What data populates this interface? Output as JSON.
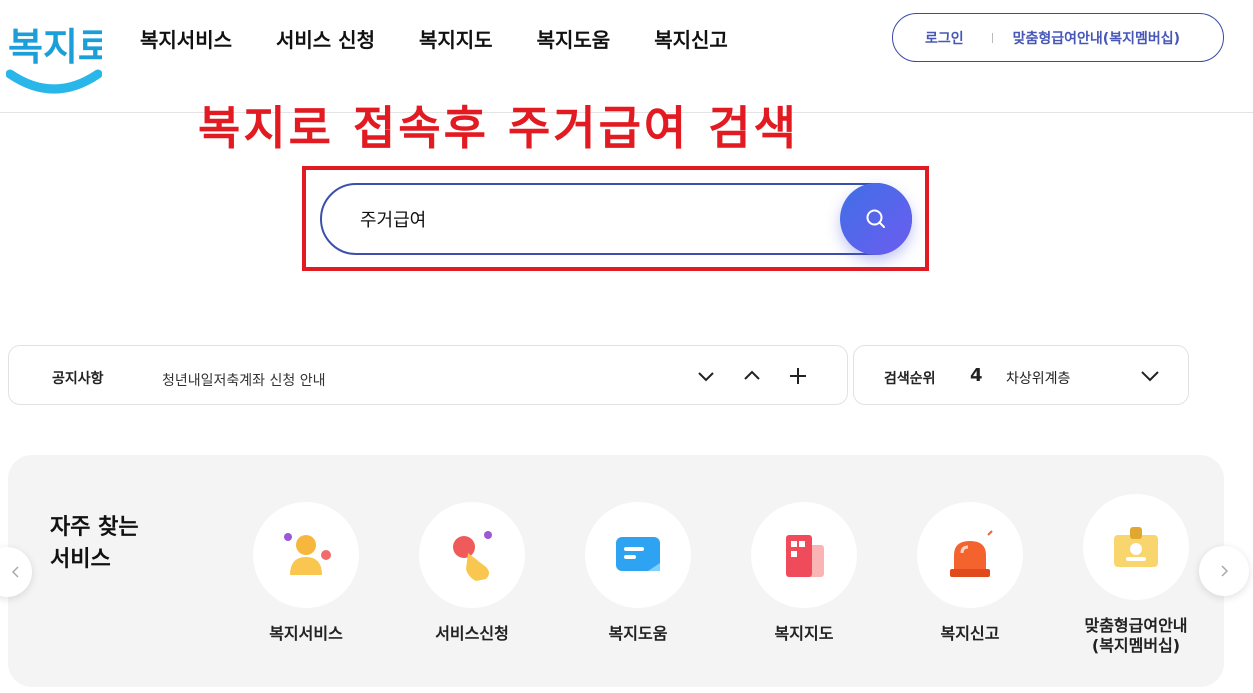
{
  "logo": {
    "text": "복지로"
  },
  "nav": [
    "복지서비스",
    "서비스 신청",
    "복지지도",
    "복지도움",
    "복지신고"
  ],
  "user": {
    "login": "로그인",
    "bokji_member": "맞춤형급여안내(복지멤버십)"
  },
  "annotation": {
    "text": "복지로 접속후 주거급여 검색",
    "color": "#e21b23"
  },
  "search": {
    "value": "주거급여"
  },
  "notice": {
    "label": "공지사항",
    "text": "청년내일저축계좌 신청 안내"
  },
  "rank": {
    "label": "검색순위",
    "number": "4",
    "term": "차상위계층"
  },
  "frequent": {
    "title_line1": "자주 찾는",
    "title_line2": "서비스",
    "items": [
      {
        "label": "복지서비스",
        "icon": "person-icon"
      },
      {
        "label": "서비스신청",
        "icon": "hand-tap-icon"
      },
      {
        "label": "복지도움",
        "icon": "chat-icon"
      },
      {
        "label": "복지지도",
        "icon": "building-icon"
      },
      {
        "label": "복지신고",
        "icon": "siren-icon"
      },
      {
        "label_line1": "맞춤형급여안내",
        "label_line2": "(복지멤버십)",
        "icon": "id-card-icon"
      }
    ]
  },
  "colors": {
    "brand_blue": "#3c4fae",
    "nav_purple": "#4757b8",
    "accent_red": "#e21b23"
  }
}
